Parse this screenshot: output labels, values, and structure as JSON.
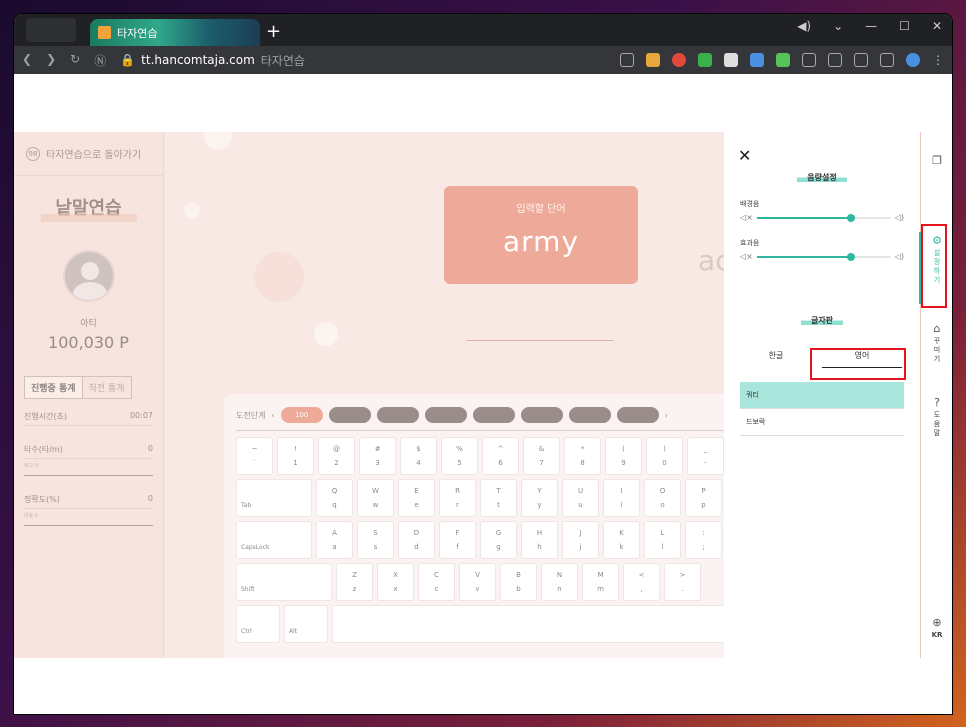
{
  "browser": {
    "tab_title": "타자연습",
    "new_tab": "+",
    "url_host": "tt.hancomtaja.com",
    "url_title": "타자연습"
  },
  "left": {
    "back_label": "타자연습으로 돌아가기",
    "title": "낱말연습",
    "user_name": "아티",
    "points": "100,030 P",
    "tab_active": "진행중 통계",
    "tab_inactive": "직전 통계",
    "stats": [
      {
        "label": "진행시간(초)",
        "value": "00:07"
      },
      {
        "label": "타수(타/m)",
        "value": "0",
        "sub": "최고 0"
      },
      {
        "label": "정확도(%)",
        "value": "0",
        "sub": "비율 0"
      }
    ]
  },
  "main": {
    "word_label": "입력할 단어",
    "word": "army",
    "next_word": "ac",
    "level_label": "도전단계",
    "level_value": "100",
    "prev": "‹",
    "next": "›"
  },
  "keyboard": {
    "row1": [
      [
        "~",
        "`"
      ],
      [
        "!",
        "1"
      ],
      [
        "@",
        "2"
      ],
      [
        "#",
        "3"
      ],
      [
        "$",
        "4"
      ],
      [
        "%",
        "5"
      ],
      [
        "^",
        "6"
      ],
      [
        "&",
        "7"
      ],
      [
        "*",
        "8"
      ],
      [
        "(",
        "9"
      ],
      [
        ")",
        "0"
      ],
      [
        "_",
        "-"
      ]
    ],
    "row2_lead": "Tab",
    "row2": [
      [
        "Q",
        "q"
      ],
      [
        "W",
        "w"
      ],
      [
        "E",
        "e"
      ],
      [
        "R",
        "r"
      ],
      [
        "T",
        "t"
      ],
      [
        "Y",
        "y"
      ],
      [
        "U",
        "u"
      ],
      [
        "I",
        "i"
      ],
      [
        "O",
        "o"
      ],
      [
        "P",
        "p"
      ]
    ],
    "row3_lead": "CapsLock",
    "row3": [
      [
        "A",
        "a"
      ],
      [
        "S",
        "s"
      ],
      [
        "D",
        "d"
      ],
      [
        "F",
        "f"
      ],
      [
        "G",
        "g"
      ],
      [
        "H",
        "h"
      ],
      [
        "J",
        "j"
      ],
      [
        "K",
        "k"
      ],
      [
        "L",
        "l"
      ],
      [
        ":",
        ";"
      ]
    ],
    "row4_lead": "Shift",
    "row4": [
      [
        "Z",
        "z"
      ],
      [
        "X",
        "x"
      ],
      [
        "C",
        "c"
      ],
      [
        "V",
        "v"
      ],
      [
        "B",
        "b"
      ],
      [
        "N",
        "n"
      ],
      [
        "M",
        "m"
      ],
      [
        "<",
        ","
      ],
      [
        ">",
        "."
      ]
    ],
    "row5": [
      "Ctrl",
      "Alt"
    ]
  },
  "settings": {
    "close": "✕",
    "sound_title": "음량설정",
    "bgm_label": "배경음",
    "sfx_label": "효과음",
    "bgm_value": 0.7,
    "sfx_value": 0.7,
    "font_title": "글자판",
    "font_tab_korean": "한글",
    "font_tab_english": "영어",
    "fonts": [
      "쿼티",
      "드보락"
    ]
  },
  "rail": {
    "settings": "설\n정\n하\n기",
    "decorate": "꾸\n미\n기",
    "help": "도\n움\n말",
    "lang": "KR"
  },
  "colors": {
    "accent": "#2fb8a0",
    "word_box": "#e4765a",
    "highlight": "#e3141b"
  }
}
